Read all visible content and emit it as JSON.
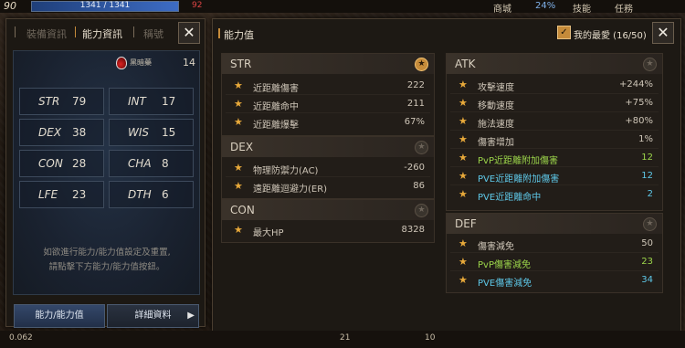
{
  "hud": {
    "level": "90",
    "hp": "1341 / 1341",
    "num": "92",
    "menu_shop": "商城",
    "pct": "24%",
    "menu_skill": "技能",
    "menu_task": "任務"
  },
  "left_panel": {
    "tabs": [
      "裝備資訊",
      "能力資訊",
      "稱號"
    ],
    "potion_label": "黑暗藥",
    "potion_value": "14",
    "stats": [
      {
        "key": "STR",
        "value": "79"
      },
      {
        "key": "INT",
        "value": "17"
      },
      {
        "key": "DEX",
        "value": "38"
      },
      {
        "key": "WIS",
        "value": "15"
      },
      {
        "key": "CON",
        "value": "28"
      },
      {
        "key": "CHA",
        "value": "8"
      },
      {
        "key": "LFE",
        "value": "23"
      },
      {
        "key": "DTH",
        "value": "6"
      }
    ],
    "note_line1": "如欲進行能力/能力值設定及重置,",
    "note_line2": "請點擊下方能力/能力值按鈕。",
    "btn_ability": "能力/能力值",
    "btn_detail": "詳細資料"
  },
  "right_panel": {
    "title": "能力值",
    "favorites_label": "我的最愛 (16/50)",
    "str": {
      "title": "STR",
      "rows": [
        {
          "name": "近距離傷害",
          "value": "222"
        },
        {
          "name": "近距離命中",
          "value": "211"
        },
        {
          "name": "近距離爆擊",
          "value": "67%"
        }
      ]
    },
    "dex": {
      "title": "DEX",
      "rows": [
        {
          "name": "物理防禦力(AC)",
          "value": "-260"
        },
        {
          "name": "遠距離迴避力(ER)",
          "value": "86"
        }
      ]
    },
    "con": {
      "title": "CON",
      "rows": [
        {
          "name": "最大HP",
          "value": "8328"
        }
      ]
    },
    "atk": {
      "title": "ATK",
      "rows": [
        {
          "name": "攻擊速度",
          "value": "+244%"
        },
        {
          "name": "移動速度",
          "value": "+75%"
        },
        {
          "name": "施法速度",
          "value": "+80%"
        },
        {
          "name": "傷害增加",
          "value": "1%"
        },
        {
          "name": "PvP近距離附加傷害",
          "value": "12"
        },
        {
          "name": "PVE近距離附加傷害",
          "value": "12"
        },
        {
          "name": "PVE近距離命中",
          "value": "2"
        }
      ]
    },
    "def": {
      "title": "DEF",
      "rows": [
        {
          "name": "傷害減免",
          "value": "50"
        },
        {
          "name": "PvP傷害減免",
          "value": "23"
        },
        {
          "name": "PVE傷害減免",
          "value": "34"
        }
      ]
    }
  },
  "bottom": {
    "left": "0.062",
    "mid": "21",
    "mid2": "10"
  },
  "colors": {
    "accent": "#c58b3a",
    "star": "#e8a93a",
    "pvp_green": "#9bd44a",
    "pve_cyan": "#5ec8e8"
  }
}
